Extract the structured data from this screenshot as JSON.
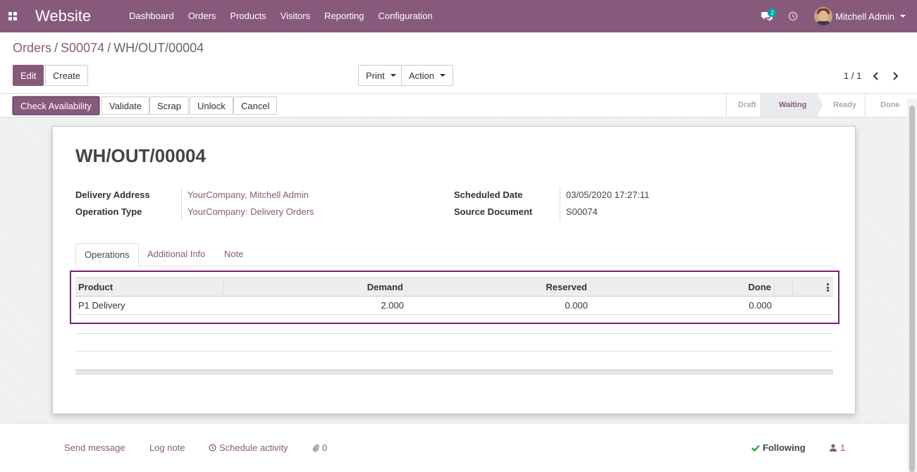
{
  "navbar": {
    "app_name": "Website",
    "menu": [
      "Dashboard",
      "Orders",
      "Products",
      "Visitors",
      "Reporting",
      "Configuration"
    ],
    "messages_count": "2",
    "user_name": "Mitchell Admin"
  },
  "breadcrumb": {
    "items": [
      "Orders",
      "S00074"
    ],
    "current": "WH/OUT/00004"
  },
  "buttons": {
    "edit": "Edit",
    "create": "Create",
    "print": "Print",
    "action": "Action"
  },
  "pager": {
    "value": "1 / 1"
  },
  "statusbar": {
    "buttons": [
      "Check Availability",
      "Validate",
      "Scrap",
      "Unlock",
      "Cancel"
    ],
    "stages": [
      "Draft",
      "Waiting",
      "Ready",
      "Done"
    ],
    "active_stage": "Waiting"
  },
  "form": {
    "title": "WH/OUT/00004",
    "delivery_address_label": "Delivery Address",
    "delivery_address": "YourCompany, Mitchell Admin",
    "operation_type_label": "Operation Type",
    "operation_type": "YourCompany: Delivery Orders",
    "scheduled_date_label": "Scheduled Date",
    "scheduled_date": "03/05/2020 17:27:11",
    "source_document_label": "Source Document",
    "source_document": "S00074"
  },
  "tabs": [
    "Operations",
    "Additional Info",
    "Note"
  ],
  "table": {
    "columns": [
      "Product",
      "Demand",
      "Reserved",
      "Done"
    ],
    "rows": [
      {
        "product": "P1 Delivery",
        "demand": "2.000",
        "reserved": "0.000",
        "done": "0.000"
      }
    ]
  },
  "chatter": {
    "send_message": "Send message",
    "log_note": "Log note",
    "schedule_activity": "Schedule activity",
    "attachments": "0",
    "following": "Following",
    "followers": "1"
  },
  "colors": {
    "brand": "#875a7b",
    "badge": "#00a09d",
    "following": "#28a745"
  }
}
